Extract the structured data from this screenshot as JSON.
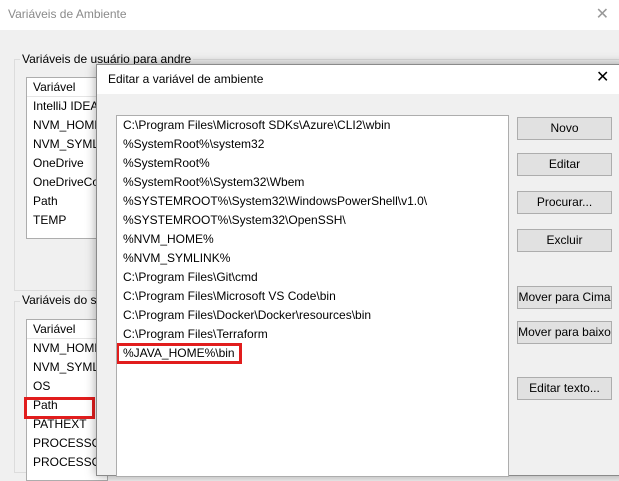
{
  "outer": {
    "title": "Variáveis de Ambiente",
    "close_icon": "close-icon",
    "user_group_label": "Variáveis de usuário para andre",
    "user_header": "Variável",
    "user_vars": [
      "IntelliJ IDEA",
      "NVM_HOME",
      "NVM_SYML",
      "OneDrive",
      "OneDriveCo",
      "Path",
      "TEMP"
    ],
    "system_group_label": "Variáveis do si",
    "system_header": "Variável",
    "system_vars": [
      "NVM_HOME",
      "NVM_SYML",
      "OS",
      "Path",
      "PATHEXT",
      "PROCESSOF",
      "PROCESSO"
    ]
  },
  "dialog": {
    "title": "Editar a variável de ambiente",
    "close_icon": "close-icon",
    "paths": [
      "C:\\Program Files\\Microsoft SDKs\\Azure\\CLI2\\wbin",
      "%SystemRoot%\\system32",
      "%SystemRoot%",
      "%SystemRoot%\\System32\\Wbem",
      "%SYSTEMROOT%\\System32\\WindowsPowerShell\\v1.0\\",
      "%SYSTEMROOT%\\System32\\OpenSSH\\",
      "%NVM_HOME%",
      "%NVM_SYMLINK%",
      "C:\\Program Files\\Git\\cmd",
      "C:\\Program Files\\Microsoft VS Code\\bin",
      "C:\\Program Files\\Docker\\Docker\\resources\\bin",
      "C:\\Program Files\\Terraform",
      "%JAVA_HOME%\\bin"
    ],
    "buttons": {
      "new": "Novo",
      "edit": "Editar",
      "browse": "Procurar...",
      "delete": "Excluir",
      "move_up": "Mover para Cima",
      "move_down": "Mover para baixo",
      "edit_text": "Editar texto..."
    }
  },
  "colors": {
    "highlight": "#e11d1d"
  }
}
